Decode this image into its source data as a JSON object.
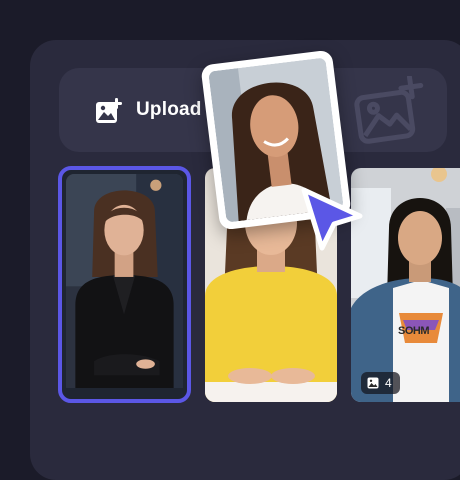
{
  "upload": {
    "label": "Upload",
    "icon": "image-plus-icon"
  },
  "ghost": {
    "icon": "image-plus-icon"
  },
  "gallery": {
    "badge_count": "4",
    "shirt_text": "SOHM"
  },
  "colors": {
    "background": "#1b1b29",
    "panel": "#2a2a3d",
    "upload_bar": "#35354a",
    "accent": "#5b57e6"
  }
}
